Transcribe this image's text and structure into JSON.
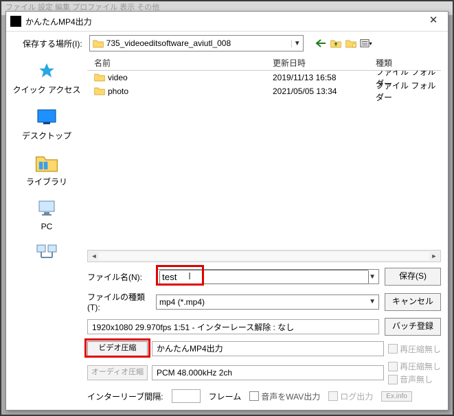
{
  "bg_menu": "ファイル  設定  編集  プロファイル  表示  その他",
  "dialog": {
    "title": "かんたんMP4出力",
    "save_in_label": "保存する場所(I):",
    "location": "735_videoeditsoftware_aviutl_008"
  },
  "columns": {
    "name": "名前",
    "date": "更新日時",
    "type": "種類"
  },
  "files": [
    {
      "name": "video",
      "date": "2019/11/13 16:58",
      "type": "ファイル フォルダー"
    },
    {
      "name": "photo",
      "date": "2021/05/05 13:34",
      "type": "ファイル フォルダー"
    }
  ],
  "sidebar": {
    "quick": "クイック アクセス",
    "desktop": "デスクトップ",
    "library": "ライブラリ",
    "pc": "PC",
    "network": "ネットワーク"
  },
  "filename_label": "ファイル名(N):",
  "filename_value": "test",
  "filetype_label": "ファイルの種類(T):",
  "filetype_value": "mp4 (*.mp4)",
  "save_btn": "保存(S)",
  "cancel_btn": "キャンセル",
  "batch_btn": "バッチ登録",
  "video_info": "1920x1080  29.970fps  1:51  -  インターレース解除 : なし",
  "video_codec_btn": "ビデオ圧縮",
  "video_codec_val": "かんたんMP4出力",
  "audio_codec_btn": "オーディオ圧縮",
  "audio_codec_val": "PCM 48.000kHz 2ch",
  "no_recompress_v": "再圧縮無し",
  "no_recompress_a": "再圧縮無し",
  "no_audio": "音声無し",
  "interleave_label": "インターリーブ間隔:",
  "frame_unit": "フレーム",
  "wav_out": "音声をWAV出力",
  "log_out": "ログ出力",
  "exinfo": "Ex.info"
}
